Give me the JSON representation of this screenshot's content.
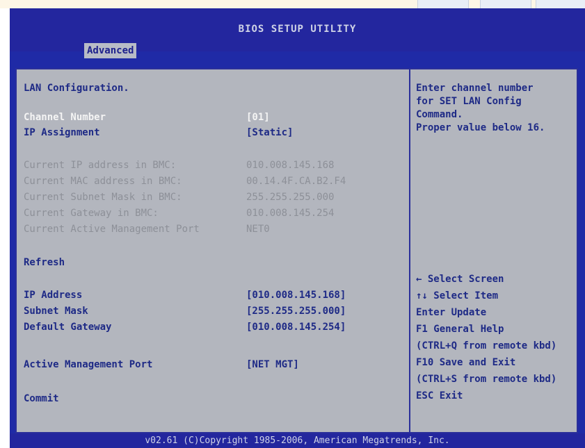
{
  "title": "BIOS SETUP UTILITY",
  "active_tab": "Advanced",
  "section_title": "LAN Configuration.",
  "items": [
    {
      "label": "Channel Number",
      "value": "[01]"
    },
    {
      "label": "IP Assignment",
      "value": "[Static]"
    }
  ],
  "info": [
    {
      "label": "Current IP address in BMC:",
      "value": "010.008.145.168"
    },
    {
      "label": "Current MAC address in BMC:",
      "value": "00.14.4F.CA.B2.F4"
    },
    {
      "label": "Current Subnet Mask in BMC:",
      "value": "255.255.255.000"
    },
    {
      "label": "Current Gateway in BMC:",
      "value": "010.008.145.254"
    },
    {
      "label": "Current Active Management Port",
      "value": "NET0"
    }
  ],
  "refresh_label": "Refresh",
  "addr_items": [
    {
      "label": "IP Address",
      "value": "[010.008.145.168]"
    },
    {
      "label": "Subnet Mask",
      "value": "[255.255.255.000]"
    },
    {
      "label": "Default Gateway",
      "value": "[010.008.145.254]"
    }
  ],
  "active_port": {
    "label": "Active Management Port",
    "value": "[NET MGT]"
  },
  "commit_label": "Commit",
  "help_text": [
    "Enter channel number",
    "for SET LAN Config",
    "Command.",
    "Proper value below 16."
  ],
  "keys": [
    "←   Select Screen",
    "↑↓    Select Item",
    "Enter Update",
    "F1    General Help",
    "(CTRL+Q from remote kbd)",
    "F10   Save and Exit",
    "(CTRL+S from remote kbd)",
    "ESC   Exit"
  ],
  "footer": "v02.61 (C)Copyright 1985-2006, American Megatrends, Inc.",
  "colors": {
    "frame": "#1f2aa6",
    "panel": "#b3b6be",
    "highlight": "#f4f4f4",
    "text": "#1e2a86"
  }
}
